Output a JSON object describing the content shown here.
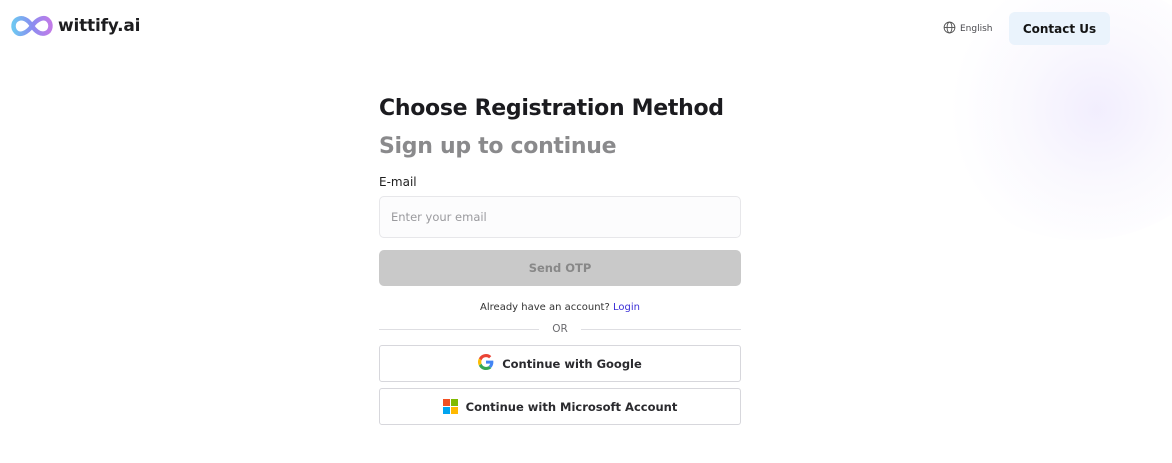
{
  "header": {
    "logo_text": "wittify.ai",
    "language_label": "English",
    "contact_label": "Contact Us"
  },
  "form": {
    "title": "Choose Registration Method",
    "subtitle": "Sign up to continue",
    "email_label": "E-mail",
    "email_placeholder": "Enter your email",
    "email_value": "",
    "send_otp_label": "Send OTP",
    "account_prompt": "Already have an account?",
    "login_label": "Login",
    "divider_label": "OR",
    "google_label": "Continue with Google",
    "microsoft_label": "Continue with Microsoft Account"
  },
  "icons": {
    "logo": "infinity-logo-icon",
    "language": "globe-icon",
    "google": "google-icon",
    "microsoft": "microsoft-icon"
  },
  "colors": {
    "contact_bg": "#eaf3fc",
    "otp_disabled_bg": "#c9c9c9",
    "login_link": "#3b2fd6",
    "subtitle": "#8a8a8c"
  }
}
